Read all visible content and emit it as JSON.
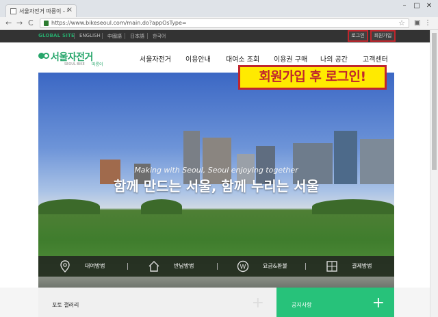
{
  "browser": {
    "tab_title": "서울자전거 따릉이 - 무",
    "tab_close": "×",
    "url": "https://www.bikeseoul.com/main.do?appOsType=",
    "back": "←",
    "forward": "→",
    "reload": "C",
    "bookmark_star": "☆",
    "menu": "⋮",
    "minimize": "–",
    "maximize": "□",
    "close": "✕"
  },
  "topbar": {
    "global_site": "GLOBAL SITE",
    "languages": [
      "ENGLISH",
      "中國語",
      "日本語",
      "한국어"
    ],
    "login": "로그인",
    "signup": "회원가입"
  },
  "header": {
    "logo_text": "서울자전거",
    "logo_sub": "SEOUL BIKE",
    "logo_sub2": "따릉이",
    "nav": [
      "서울자전거",
      "이용안내",
      "대여소 조회",
      "이용권 구매",
      "나의 공간",
      "고객센터"
    ]
  },
  "annotation": "회원가입 후 로그인!",
  "hero": {
    "subtitle": "Making with Seoul, Seoul enjoying together",
    "title": "함께 만드는 서울, 함께 누리는 서울"
  },
  "quick_menu": [
    {
      "label": "대여방법",
      "icon": "map-pin-icon"
    },
    {
      "label": "반납방법",
      "icon": "home-icon"
    },
    {
      "label": "요금&환불",
      "icon": "won-icon"
    },
    {
      "label": "결제방법",
      "icon": "calculator-icon"
    }
  ],
  "panels": {
    "photo_gallery": "포토 갤러리",
    "notice": "공지사항",
    "plus": "+"
  },
  "colors": {
    "brand_green": "#27a66b",
    "notice_green": "#27c27a",
    "annotation_red": "#c0262d",
    "annotation_yellow": "#ffea00"
  }
}
